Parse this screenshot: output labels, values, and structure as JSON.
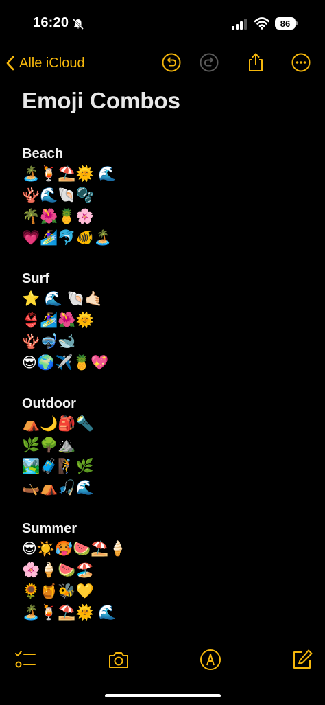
{
  "status": {
    "time": "16:20",
    "battery": "86"
  },
  "nav": {
    "back_label": "Alle iCloud",
    "icons": [
      "undo-icon",
      "redo-icon",
      "share-icon",
      "more-icon"
    ]
  },
  "note": {
    "title": "Emoji Combos",
    "sections": [
      {
        "heading": "Beach",
        "lines": [
          "🏝️🍹⛱️🌞 🌊",
          "🪸🌊🐚🫧",
          "🌴🌺🍍🌸",
          "💗🏄‍♀️🐬🐠🏝️"
        ]
      },
      {
        "heading": "Surf",
        "lines": [
          "⭐️ 🌊 🐚🤙🏻",
          "👙🏄‍♀️🌺🌞",
          "🪸🤿🐋",
          "😎🌍✈️🍍💖"
        ]
      },
      {
        "heading": "Outdoor",
        "lines": [
          "⛺️🌙🎒🔦",
          "🌿🌳⛰️",
          "🏞️🧳🧗🌿",
          "🛶⛺️🎣🌊"
        ]
      },
      {
        "heading": "Summer",
        "lines": [
          "😎☀️🥵🍉⛱️🍦",
          "🌸🍦🍉🏖️",
          "🌻🍯🐝💛",
          "🏝️🍹⛱️🌞 🌊"
        ]
      }
    ]
  },
  "toolbar": {
    "icons": [
      "checklist-icon",
      "camera-icon",
      "markup-icon",
      "compose-icon"
    ]
  },
  "colors": {
    "accent": "#f5b70c",
    "background": "#000000",
    "text": "#ffffff"
  }
}
